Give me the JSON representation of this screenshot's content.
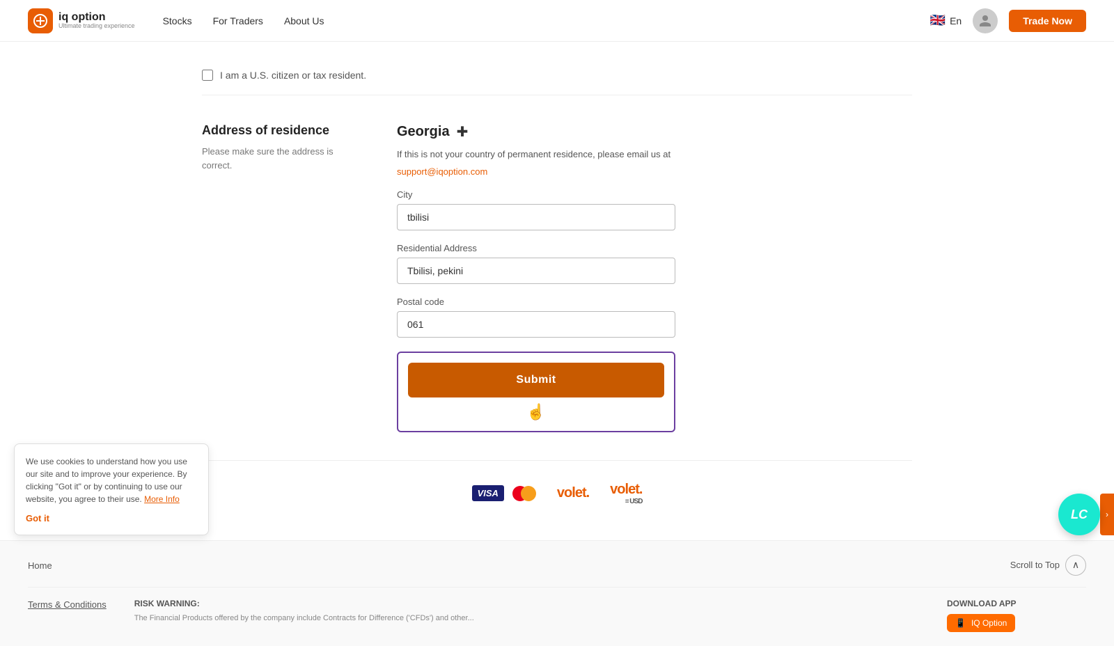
{
  "header": {
    "logo_text": "iq option",
    "logo_tagline": "Ultimate trading experience",
    "nav": [
      {
        "label": "Stocks"
      },
      {
        "label": "For Traders"
      },
      {
        "label": "About Us"
      }
    ],
    "lang": "En",
    "trade_now_label": "Trade Now"
  },
  "us_citizen": {
    "label": "I am a U.S. citizen or tax resident."
  },
  "address_section": {
    "title": "Address of residence",
    "description_line1": "Please make sure the address is",
    "description_line2": "correct.",
    "country": "Georgia",
    "country_info": "If this is not your country of permanent residence, please email us at",
    "support_email": "support@iqoption.com",
    "city_label": "City",
    "city_value": "tbilisi",
    "residential_label": "Residential Address",
    "residential_value": "Tbilisi, pekini",
    "postal_label": "Postal code",
    "postal_value": "061",
    "submit_label": "Submit"
  },
  "footer": {
    "nav": [
      {
        "label": "Home"
      },
      {
        "label": "Terms & Conditions"
      }
    ],
    "scroll_to_top": "Scroll to Top",
    "risk_title": "RISK WARNING:",
    "risk_text": "The Financial Products offered by the company include Contracts for Difference ('CFDs') and other...",
    "download_title": "DOWNLOAD APP",
    "download_label": "IQ Option"
  },
  "cookie": {
    "text": "We use cookies to understand how you use our site and to improve your experience. By clicking \"Got it\" or by continuing to use our website, you agree to their use.",
    "more_info": "More Info",
    "got_it": "Got it"
  },
  "chat": {
    "label": "LC"
  }
}
